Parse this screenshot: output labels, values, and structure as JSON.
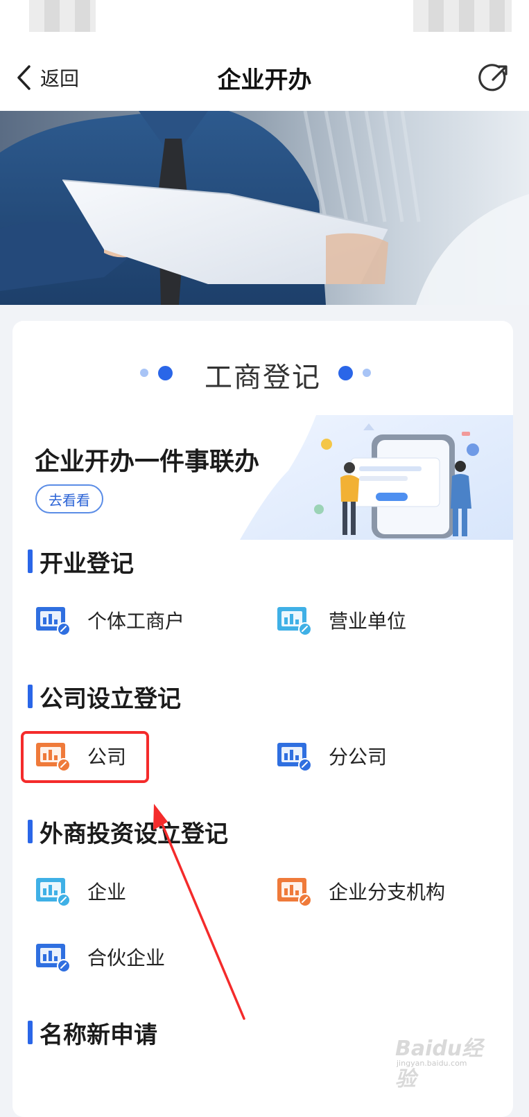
{
  "nav": {
    "back_label": "返回",
    "title": "企业开办"
  },
  "card": {
    "title": "工商登记",
    "promo": {
      "title": "企业开办一件事联办",
      "button": "去看看"
    },
    "sections": [
      {
        "title": "开业登记",
        "items": [
          {
            "label": "个体工商户",
            "icon": "building-form-icon",
            "color": "#2f6fe0"
          },
          {
            "label": "营业单位",
            "icon": "building-form-icon",
            "color": "#3fb0e6"
          }
        ]
      },
      {
        "title": "公司设立登记",
        "items": [
          {
            "label": "公司",
            "icon": "building-form-icon",
            "color": "#ef7a3a"
          },
          {
            "label": "分公司",
            "icon": "building-form-icon",
            "color": "#2f6fe0"
          }
        ]
      },
      {
        "title": "外商投资设立登记",
        "items": [
          {
            "label": "企业",
            "icon": "building-form-icon",
            "color": "#3fb0e6"
          },
          {
            "label": "企业分支机构",
            "icon": "building-form-icon",
            "color": "#ef7a3a"
          },
          {
            "label": "合伙企业",
            "icon": "building-form-icon",
            "color": "#2f6fe0"
          }
        ]
      },
      {
        "title": "名称新申请",
        "items": []
      }
    ]
  },
  "watermark": {
    "text": "Baidu经验",
    "sub": "jingyan.baidu.com"
  },
  "colors": {
    "accent": "#2a66e8",
    "highlight": "#f42b2b"
  }
}
